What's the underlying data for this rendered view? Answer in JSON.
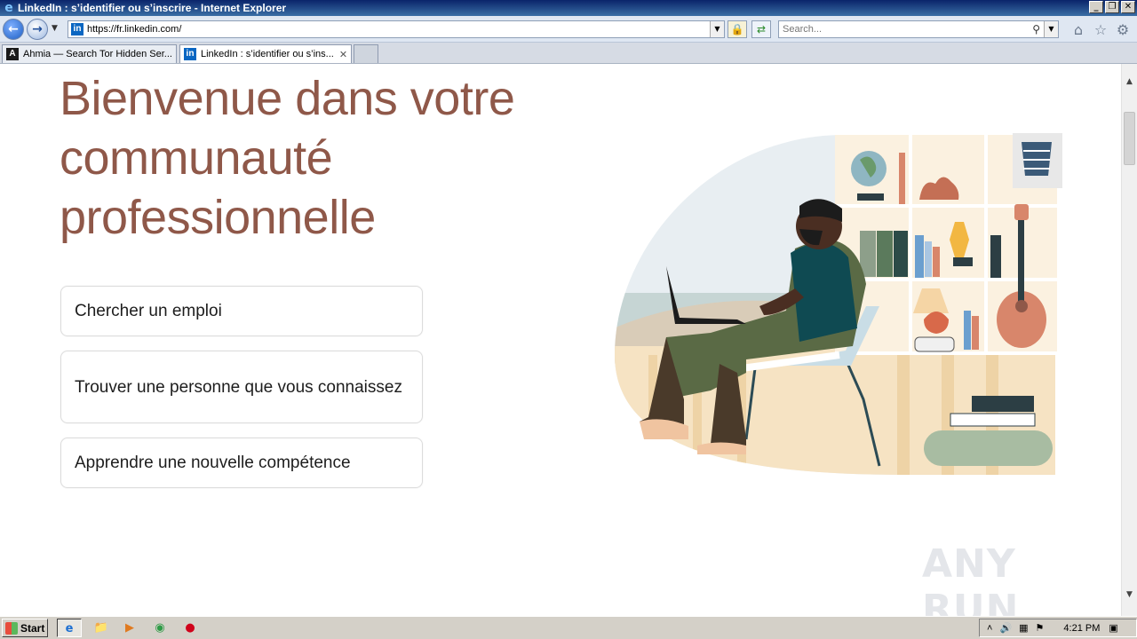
{
  "window": {
    "title": "LinkedIn : s’identifier ou s’inscrire - Internet Explorer",
    "buttons": [
      "_",
      "❐",
      "✕"
    ]
  },
  "nav": {
    "url": "https://fr.linkedin.com/",
    "search_placeholder": "Search..."
  },
  "tabs": [
    {
      "label": "Ahmia — Search Tor Hidden Ser...",
      "favicon": "A"
    },
    {
      "label": "LinkedIn : s’identifier ou s’ins...",
      "favicon": "in",
      "active": true
    }
  ],
  "page": {
    "headline": "Bienvenue dans votre communauté professionnelle",
    "options": [
      "Chercher un emploi",
      "Trouver une personne que vous connaissez",
      "Apprendre une nouvelle compétence"
    ],
    "watermark": "ANY RUN"
  },
  "taskbar": {
    "start_label": "Start",
    "clock": "4:21 PM"
  },
  "colors": {
    "headline": "#8f5849",
    "linkedin_blue": "#0a66c2"
  }
}
